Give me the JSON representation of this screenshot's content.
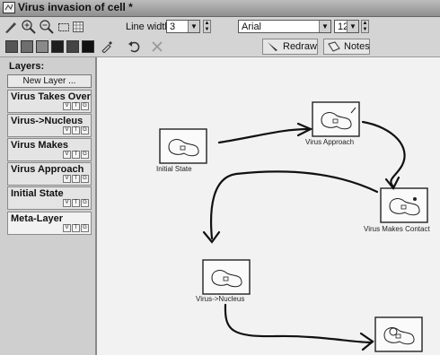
{
  "window": {
    "title": "Virus invasion of cell *"
  },
  "toolbar": {
    "line_width_label": "Line width:",
    "line_width_value": "3",
    "font_value": "Arial",
    "font_size_value": "12",
    "redraw_label": "Redraw",
    "notes_label": "Notes"
  },
  "colors": {
    "swatches": [
      "#555555",
      "#6e6e6e",
      "#8a8a8a",
      "#1e1e1e",
      "#444444",
      "#111111"
    ]
  },
  "sidebar": {
    "title": "Layers:",
    "new_layer_label": "New Layer ...",
    "layers": [
      {
        "name": "Virus Takes Over",
        "flags": [
          "V",
          "T",
          "G"
        ]
      },
      {
        "name": "Virus->Nucleus",
        "flags": [
          "V",
          "T",
          "G"
        ]
      },
      {
        "name": "Virus Makes",
        "flags": [
          "V",
          "T",
          "G"
        ]
      },
      {
        "name": "Virus Approach",
        "flags": [
          "V",
          "T",
          "G"
        ]
      },
      {
        "name": "Initial State",
        "flags": [
          "V",
          "T",
          "G"
        ]
      },
      {
        "name": "Meta-Layer",
        "flags": [
          "V",
          "T",
          "G"
        ]
      }
    ]
  },
  "canvas": {
    "nodes": [
      {
        "label": "Initial State"
      },
      {
        "label": "Virus Approach"
      },
      {
        "label": "Virus Makes Contact"
      },
      {
        "label": "Virus->Nucleus"
      },
      {
        "label": ""
      }
    ]
  }
}
